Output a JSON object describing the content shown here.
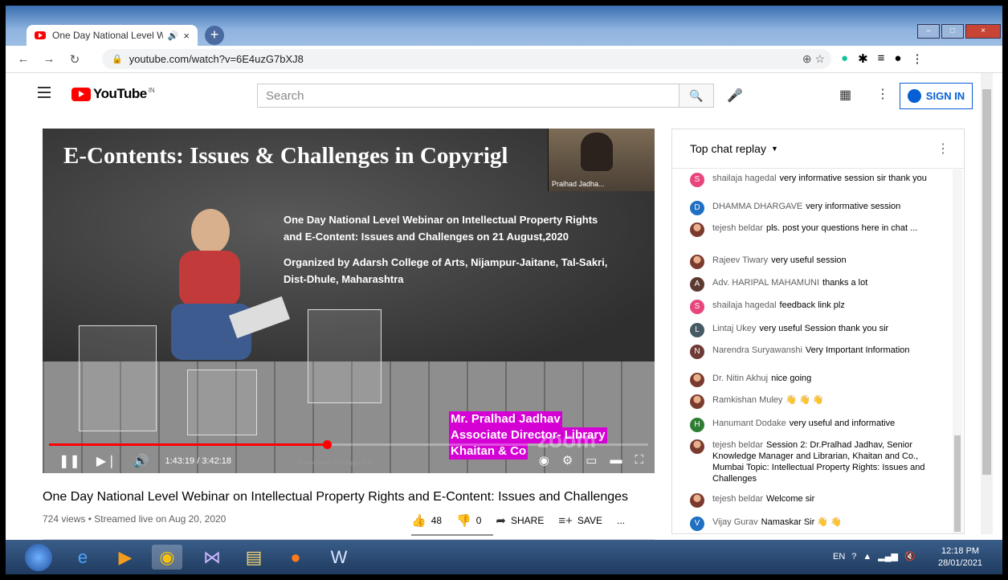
{
  "tab": {
    "title": "One Day National Level Web",
    "audio_icon": "speaker-icon",
    "close": "×",
    "new_tab": "+"
  },
  "window": {
    "min": "–",
    "max": "□",
    "close": "×"
  },
  "address": {
    "url": "youtube.com/watch?v=6E4uzG7bXJ8"
  },
  "youtube": {
    "logo_text": "YouTube",
    "country": "IN",
    "search_placeholder": "Search",
    "sign_in": "SIGN IN"
  },
  "video": {
    "slide_title": "E-Contents: Issues & Challenges in Copyrigl",
    "pip_name": "Pralhad Jadha...",
    "slide_line1": "One Day National Level Webinar on Intellectual Property Rights",
    "slide_line2": "and E-Content: Issues and Challenges on 21 August,2020",
    "slide_line3": "Organized by Adarsh College of Arts, Nijampur-Jaitane, Tal-Sakri,",
    "slide_line4": "Dist-Dhule, Maharashtra",
    "speaker1": "Mr. Pralhad Jadhav",
    "speaker2": "Associate Director- Library",
    "speaker3": "Khaitan & Co",
    "zoom_watermark": "zoom",
    "watermark": "Pralhad Jadhav 21st August 2020",
    "time": "1:43:19 / 3:42:18",
    "progress_fraction": 0.464
  },
  "details": {
    "title": "One Day National Level Webinar on Intellectual Property Rights and E-Content: Issues and Challenges",
    "meta": "724 views • Streamed live on Aug 20, 2020",
    "likes": "48",
    "dislikes": "0",
    "share": "SHARE",
    "save": "SAVE",
    "more": "..."
  },
  "chat": {
    "header": "Top chat replay",
    "messages": [
      {
        "initial": "S",
        "color": "#e8457c",
        "author": "shailaja hagedal",
        "text": "very informative session sir thank you"
      },
      {
        "initial": "D",
        "color": "#1f6fc2",
        "author": "DHAMMA DHARGAVE",
        "text": "very informative session"
      },
      {
        "initial": "",
        "color": "photo",
        "author": "tejesh beldar",
        "text": "pls. post your questions here in chat ..."
      },
      {
        "initial": "",
        "color": "photo",
        "author": "Rajeev Tiwary",
        "text": "very useful session"
      },
      {
        "initial": "A",
        "color": "#5d3a31",
        "author": "Adv. HARIPAL MAHAMUNI",
        "text": "thanks a lot"
      },
      {
        "initial": "S",
        "color": "#e8457c",
        "author": "shailaja hagedal",
        "text": "feedback link plz"
      },
      {
        "initial": "L",
        "color": "#455a64",
        "author": "Lintaj Ukey",
        "text": "very useful Session thank you sir"
      },
      {
        "initial": "N",
        "color": "#6d3b33",
        "author": "Narendra Suryawanshi",
        "text": "Very Important Information"
      },
      {
        "initial": "",
        "color": "photo",
        "author": "Dr. Nitin Akhuj",
        "text": "nice going"
      },
      {
        "initial": "",
        "color": "photo",
        "author": "Ramkishan Muley",
        "text": "👋 👋 👋"
      },
      {
        "initial": "H",
        "color": "#2e7d32",
        "author": "Hanumant Dodake",
        "text": "very useful and informative"
      },
      {
        "initial": "",
        "color": "photo",
        "author": "tejesh beldar",
        "text": "Session 2: Dr.Pralhad Jadhav, Senior Knowledge Manager and Librarian, Khaitan and Co., Mumbai Topic: Intellectual Property Rights: Issues and Challenges"
      },
      {
        "initial": "",
        "color": "photo",
        "author": "tejesh beldar",
        "text": "Welcome sir"
      },
      {
        "initial": "V",
        "color": "#1f6fc2",
        "author": "Vijay Gurav",
        "text": "Namaskar Sir 👋 👋"
      }
    ]
  },
  "taskbar": {
    "lang": "EN",
    "time": "12:18 PM",
    "date": "28/01/2021"
  }
}
